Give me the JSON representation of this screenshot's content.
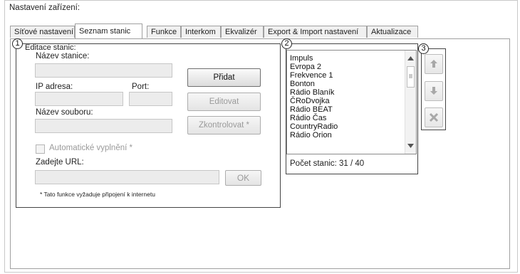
{
  "window_title": "Nastavení zařízení:",
  "tabs": [
    {
      "label": "Síťové nastavení"
    },
    {
      "label": "Seznam stanic"
    },
    {
      "label": "Funkce"
    },
    {
      "label": "Interkom"
    },
    {
      "label": "Ekvalizér"
    },
    {
      "label": "Export & Import nastavení"
    },
    {
      "label": "Aktualizace"
    }
  ],
  "active_tab": "Seznam stanic",
  "callouts": {
    "one": "1",
    "two": "2",
    "three": "3"
  },
  "edit_group": {
    "title": "Editace stanic:",
    "station_name_label": "Název stanice:",
    "station_name_value": "",
    "ip_label": "IP adresa:",
    "ip_value": "",
    "port_label": "Port:",
    "port_value": "",
    "file_name_label": "Název souboru:",
    "file_name_value": "",
    "add_button": "Přidat",
    "edit_button": "Editovat",
    "check_button": "Zkontrolovat *",
    "autofill_label": "Automatické vyplnění *",
    "autofill_checked": false,
    "url_label": "Zadejte URL:",
    "url_value": "",
    "ok_button": "OK",
    "footnote": "* Tato funkce vyžaduje připojení k internetu"
  },
  "station_list": {
    "items": [
      "Impuls",
      "Evropa 2",
      "Frekvence 1",
      "Bonton",
      "Rádio Blaník",
      "ČRoDvojka",
      "Rádio BEAT",
      "Rádio Čas",
      "CountryRadio",
      "Rádio Orion"
    ],
    "count_text": "Počet stanic: 31 / 40"
  },
  "side_buttons": {
    "up_icon": "arrow-up-icon",
    "down_icon": "arrow-down-icon",
    "delete_icon": "delete-x-icon"
  },
  "colors": {
    "disabled_icon": "#a8a8a8",
    "group_border": "#444444"
  }
}
